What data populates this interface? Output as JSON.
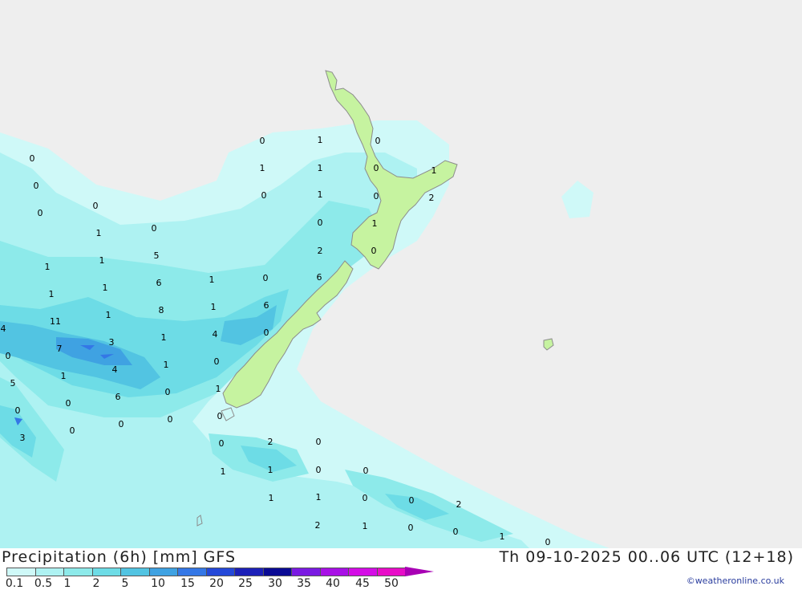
{
  "map": {
    "background_color": "#eeeeee",
    "land_color": "#c6f3a0",
    "coast_color": "#8c8c8c",
    "values": [
      "0",
      "1",
      "0",
      "1",
      "1",
      "0",
      "1",
      "0",
      "1",
      "0",
      "2",
      "0",
      "1",
      "2",
      "0",
      "1",
      "0",
      "6",
      "1",
      "6",
      "4",
      "0",
      "0",
      "1",
      "0",
      "0",
      "2",
      "0",
      "1",
      "1",
      "0",
      "0",
      "1",
      "1",
      "0",
      "0",
      "2",
      "2",
      "1",
      "0",
      "0",
      "1",
      "0",
      "0",
      "0",
      "0",
      "0",
      "1",
      "0",
      "1",
      "1",
      "5",
      "1",
      "1",
      "6",
      "11",
      "1",
      "8",
      "4",
      "7",
      "3",
      "1",
      "4",
      "1",
      "1",
      "0",
      "5",
      "6",
      "0",
      "0",
      "0",
      "0",
      "0",
      "3",
      "0"
    ]
  },
  "footer": {
    "title": "Precipitation (6h) [mm] GFS",
    "timestamp": "Th 09-10-2025 00..06 UTC (12+18)",
    "credit": "©weatheronline.co.uk"
  },
  "legend": {
    "labels": [
      "0.1",
      "0.5",
      "1",
      "2",
      "5",
      "10",
      "15",
      "20",
      "25",
      "30",
      "35",
      "40",
      "45",
      "50"
    ],
    "colors": [
      "#cff9f8",
      "#aef2f2",
      "#8deaea",
      "#6ddce6",
      "#52c4e2",
      "#3fa2e2",
      "#3477e6",
      "#2448d8",
      "#1c20b8",
      "#0a0a94",
      "#7a1ae2",
      "#a810e6",
      "#d40ce6",
      "#e80cc8",
      "#a800b4"
    ]
  }
}
